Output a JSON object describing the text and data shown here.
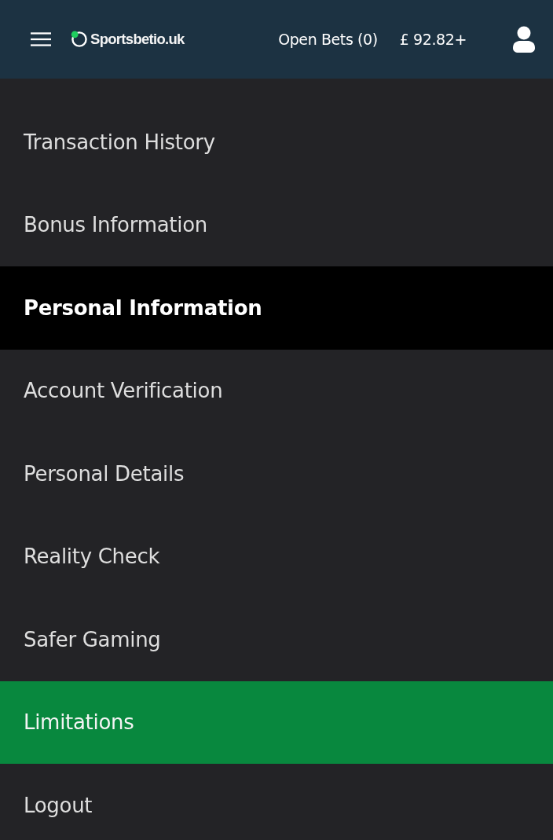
{
  "header": {
    "logo": "Sportsbetio.uk",
    "open_bets": "Open Bets (0)",
    "balance": "£ 92.82+"
  },
  "menu": [
    {
      "kind": "link",
      "label": "Transaction History",
      "selected": false
    },
    {
      "kind": "link",
      "label": "Bonus Information",
      "selected": false
    },
    {
      "kind": "heading",
      "label": "Personal Information"
    },
    {
      "kind": "link",
      "label": "Account Verification",
      "selected": false
    },
    {
      "kind": "link",
      "label": "Personal Details",
      "selected": false
    },
    {
      "kind": "link",
      "label": "Reality Check",
      "selected": false
    },
    {
      "kind": "link",
      "label": "Safer Gaming",
      "selected": false
    },
    {
      "kind": "link",
      "label": "Limitations",
      "selected": true
    },
    {
      "kind": "link",
      "label": "Logout",
      "selected": false
    }
  ]
}
